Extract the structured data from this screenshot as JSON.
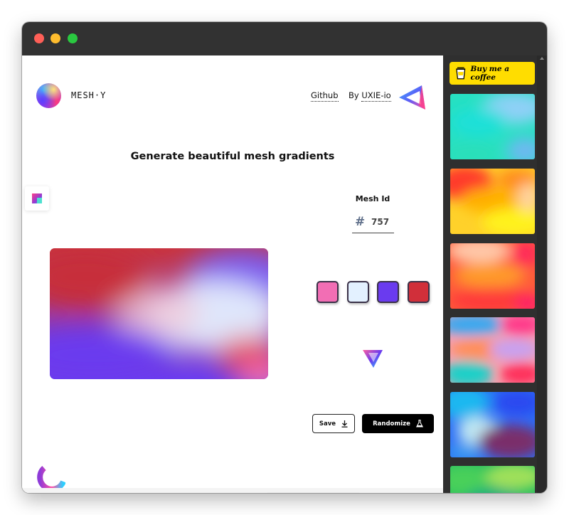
{
  "window": {
    "controls": [
      "close",
      "minimize",
      "zoom"
    ]
  },
  "header": {
    "brand": "MESH·Y",
    "links": {
      "github": "Github",
      "by_prefix": "By",
      "author": "UXIE-io"
    }
  },
  "main": {
    "headline": "Generate beautiful mesh gradients",
    "mesh_id_label": "Mesh Id",
    "mesh_id_hash": "#",
    "mesh_id_value": "757",
    "swatches": [
      "#f26eb4",
      "#e3f1ff",
      "#6a3bef",
      "#d12f3a"
    ],
    "save_label": "Save",
    "randomize_label": "Randomize"
  },
  "sidebar": {
    "coffee_label": "Buy me a coffee",
    "thumbnails": [
      {
        "name": "teal-mesh"
      },
      {
        "name": "orange-yellow-mesh"
      },
      {
        "name": "peach-red-mesh"
      },
      {
        "name": "rainbow-mesh"
      },
      {
        "name": "blue-maroon-mesh"
      },
      {
        "name": "green-mesh"
      }
    ]
  },
  "icons": {
    "logo": "orb-logo-icon",
    "author_logo": "triangle-logo-icon",
    "save": "download-icon",
    "randomize": "flask-icon",
    "coffee": "coffee-cup-icon"
  }
}
